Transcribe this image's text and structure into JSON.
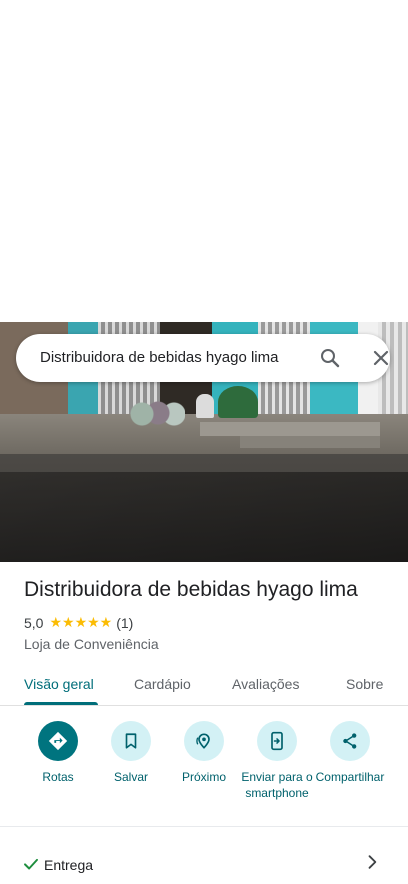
{
  "search": {
    "query": "Distribuidora de bebidas hyago lima"
  },
  "place": {
    "name": "Distribuidora de bebidas hyago lima",
    "rating": "5,0",
    "stars": "★★★★★",
    "review_count": "(1)",
    "category": "Loja de Conveniência"
  },
  "tabs": [
    {
      "label": "Visão geral",
      "active": true
    },
    {
      "label": "Cardápio",
      "active": false
    },
    {
      "label": "Avaliações",
      "active": false
    },
    {
      "label": "Sobre",
      "active": false
    }
  ],
  "actions": [
    {
      "label": "Rotas",
      "icon": "directions-icon"
    },
    {
      "label": "Salvar",
      "icon": "bookmark-icon"
    },
    {
      "label": "Próximo",
      "icon": "nearby-icon"
    },
    {
      "label": "Enviar para o smartphone",
      "icon": "send-to-phone-icon"
    },
    {
      "label": "Compartilhar",
      "icon": "share-icon"
    }
  ],
  "delivery": {
    "label": "Entrega"
  },
  "colors": {
    "accent": "#006e7a",
    "action_bg": "#d3f1f5",
    "star": "#fbbc04"
  }
}
